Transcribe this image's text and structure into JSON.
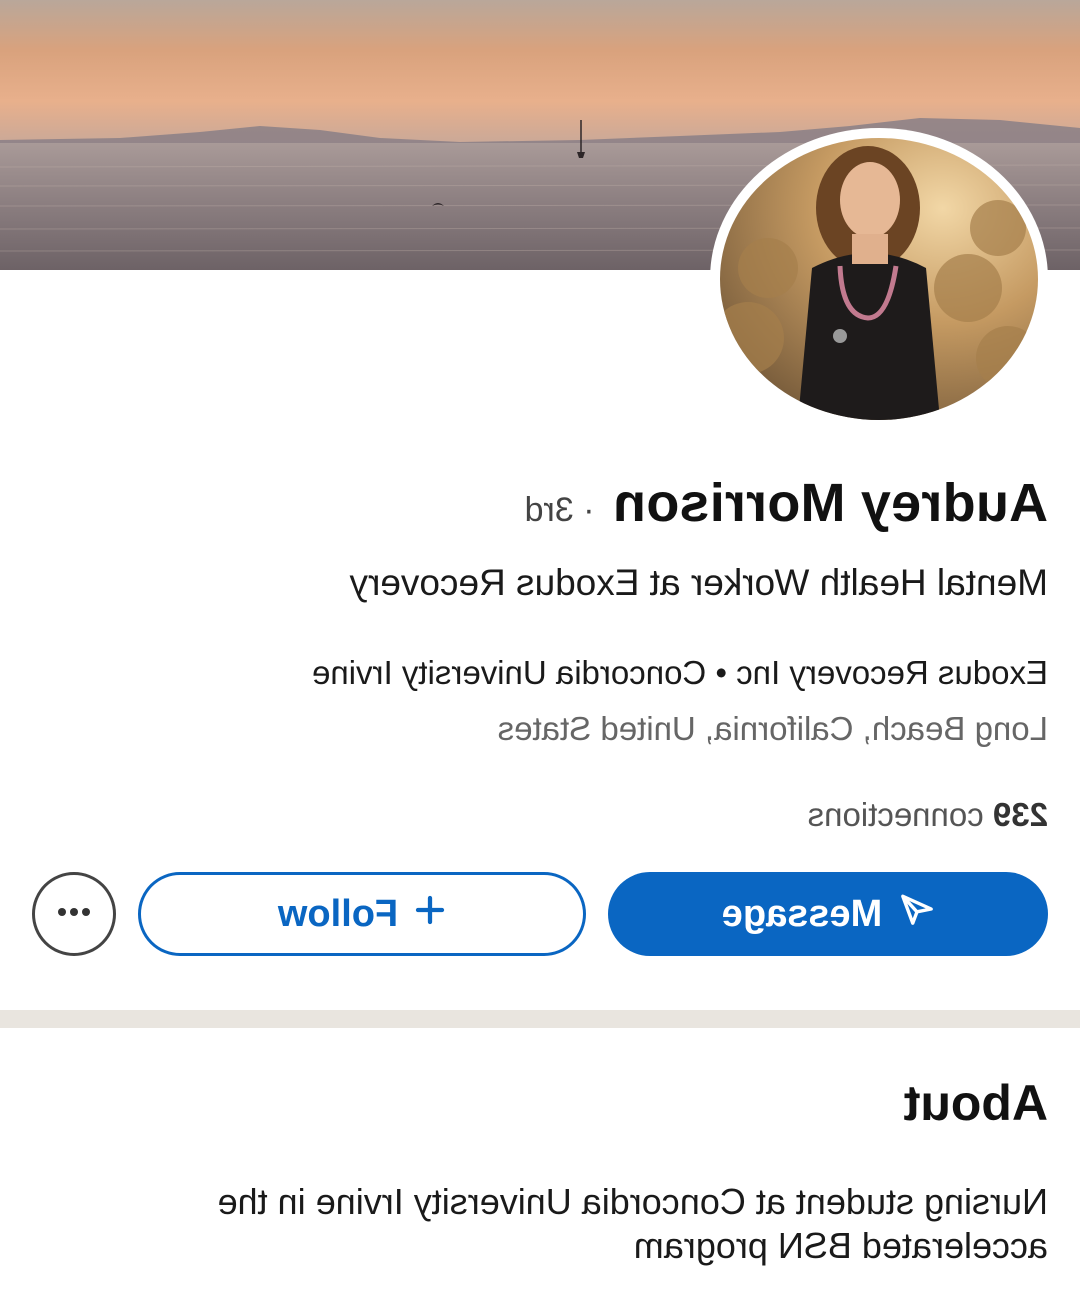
{
  "profile": {
    "name": "Audrey Morrison",
    "degree": "· 3rd",
    "headline": "Mental Health Worker at Exodus Recovery",
    "organizations": "Exodus Recovery Inc • Concordia University Irvine",
    "location": "Long Beach, California, United States",
    "connections_count": "239",
    "connections_label": "connections"
  },
  "actions": {
    "message_label": "Message",
    "follow_label": "Follow",
    "follow_icon": "plus-icon",
    "message_icon": "send-icon",
    "more_icon": "ellipsis-icon"
  },
  "about": {
    "title": "About",
    "text": "Nursing student at Concordia University Irvine in the accelerated BSN program"
  },
  "colors": {
    "accent": "#0a66c2",
    "divider": "#e9e5df",
    "text_primary": "#111111",
    "text_secondary": "#666666"
  }
}
